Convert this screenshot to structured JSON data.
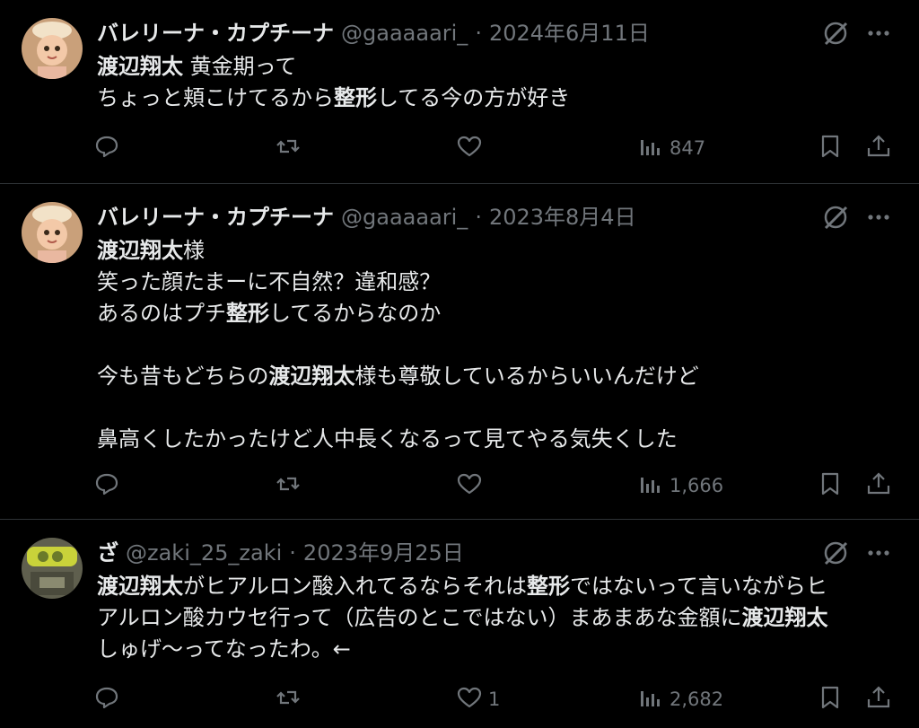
{
  "tweets": [
    {
      "name": "バレリーナ・カプチーナ",
      "handle": "@gaaaaari_",
      "dot": "·",
      "date": "2024年6月11日",
      "body_lines": [
        {
          "p1b": "渡辺翔太",
          "p2": " 黄金期って"
        },
        {
          "p1": "ちょっと頬こけてるから",
          "p2b": "整形",
          "p3": "してる今の方が好き"
        }
      ],
      "actions": {
        "replies": "",
        "reposts": "",
        "likes": "",
        "views": "847"
      }
    },
    {
      "name": "バレリーナ・カプチーナ",
      "handle": "@gaaaaari_",
      "dot": "·",
      "date": "2023年8月4日",
      "body_lines": [
        {
          "p1b": "渡辺翔太",
          "p2": "様"
        },
        {
          "p1": "笑った顔たまーに不自然？違和感？"
        },
        {
          "p1": "あるのはプチ",
          "p2b": "整形",
          "p3": "してるからなのか"
        },
        {
          "p1": "今も昔もどちらの",
          "p2b": "渡辺翔太",
          "p3": "様も尊敬しているからいいんだけど"
        },
        {
          "p1": "鼻高くしたかったけど人中長くなるって見てやる気失くした"
        }
      ],
      "actions": {
        "replies": "",
        "reposts": "",
        "likes": "",
        "views": "1,666"
      }
    },
    {
      "name": "ざ",
      "handle": "@zaki_25_zaki",
      "dot": "·",
      "date": "2023年9月25日",
      "body_lines": [
        {
          "p1b": "渡辺翔太",
          "p2": "がヒアルロン酸入れてるならそれは",
          "p3b": "整形",
          "p4": "ではないって言いながらヒ"
        },
        {
          "p1": "アルロン酸カウセ行って（広告のとこではない）まあまあな金額に",
          "p2b": "渡辺翔太"
        },
        {
          "p1": "しゅげ〜ってなったわ。←"
        }
      ],
      "actions": {
        "replies": "",
        "reposts": "",
        "likes": "1",
        "views": "2,682"
      }
    }
  ],
  "icons": {
    "grok": "grok-icon",
    "more": "more-icon",
    "reply": "reply-icon",
    "repost": "repost-icon",
    "like": "like-icon",
    "views": "views-icon",
    "bookmark": "bookmark-icon",
    "share": "share-icon"
  },
  "colors": {
    "background": "#000000",
    "text": "#e7e9ea",
    "secondary": "#71767b",
    "divider": "#2f3336"
  }
}
